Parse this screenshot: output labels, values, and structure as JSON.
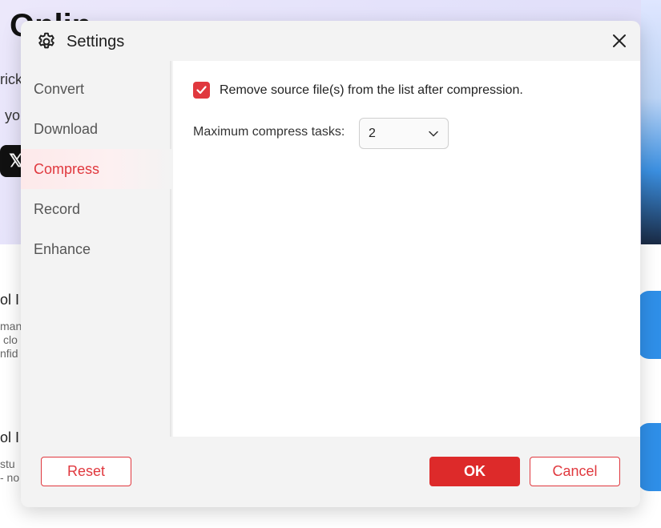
{
  "background": {
    "hero_title": "Onlin",
    "line1": "rick",
    "line2": "yo",
    "section1_title": "ol I",
    "section1_text": [
      "man",
      "clo",
      "nfid"
    ],
    "section2_title": "ol I",
    "section2_text": [
      "stu",
      "- no"
    ]
  },
  "dialog": {
    "title": "Settings",
    "sidebar": {
      "items": [
        {
          "label": "Convert"
        },
        {
          "label": "Download"
        },
        {
          "label": "Compress"
        },
        {
          "label": "Record"
        },
        {
          "label": "Enhance"
        }
      ],
      "active": "Compress"
    },
    "compress": {
      "remove_source_label": "Remove source file(s) from the list after compression.",
      "remove_source_checked": true,
      "max_tasks_label": "Maximum compress tasks:",
      "max_tasks_value": "2"
    },
    "footer": {
      "reset_label": "Reset",
      "ok_label": "OK",
      "cancel_label": "Cancel"
    }
  },
  "colors": {
    "accent": "#e0383e",
    "ok_button": "#dd2a2a"
  }
}
